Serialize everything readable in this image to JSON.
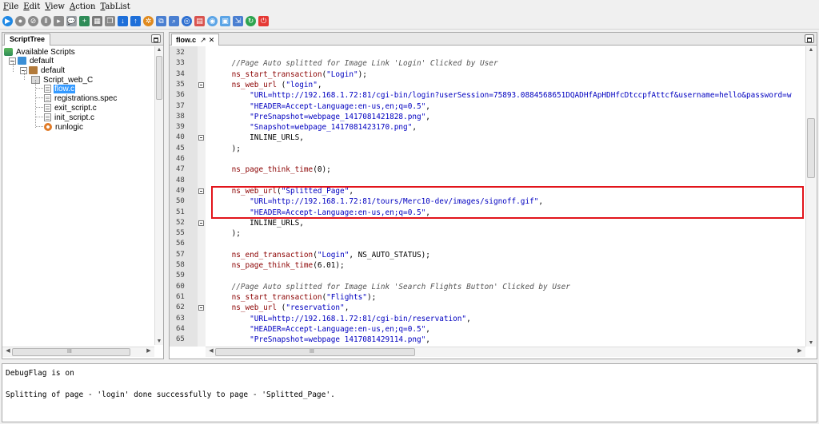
{
  "menu": [
    {
      "label": "File",
      "accel": "F"
    },
    {
      "label": "Edit",
      "accel": "E"
    },
    {
      "label": "View",
      "accel": "V"
    },
    {
      "label": "Action",
      "accel": "A"
    },
    {
      "label": "TabList",
      "accel": "T"
    }
  ],
  "toolbar": {
    "buttons": [
      {
        "name": "run-icon",
        "color": "#1e88e5",
        "shape": "round",
        "glyph": "▶"
      },
      {
        "name": "record-icon",
        "color": "#8a8a8a",
        "shape": "round",
        "glyph": "●"
      },
      {
        "name": "stop-icon",
        "color": "#8a8a8a",
        "shape": "round",
        "glyph": "⊘"
      },
      {
        "name": "pause-icon",
        "color": "#8a8a8a",
        "shape": "round",
        "glyph": "Ⅱ"
      },
      {
        "name": "step-icon",
        "color": "#8a8a8a",
        "shape": "square",
        "glyph": "▸"
      },
      {
        "name": "comment-icon",
        "color": "#9aa0a6",
        "shape": "square",
        "glyph": "💬"
      },
      {
        "name": "add-icon",
        "color": "#2e8b57",
        "shape": "square",
        "glyph": "+"
      },
      {
        "name": "grid-icon",
        "color": "#7a7a7a",
        "shape": "square",
        "glyph": "▦"
      },
      {
        "name": "copy-icon",
        "color": "#8a8a8a",
        "shape": "square",
        "glyph": "❐"
      },
      {
        "name": "move-down-icon",
        "color": "#1e6fd9",
        "shape": "square",
        "glyph": "↓"
      },
      {
        "name": "move-up-icon",
        "color": "#1e6fd9",
        "shape": "square",
        "glyph": "↑"
      },
      {
        "name": "settings-icon",
        "color": "#e08a1e",
        "shape": "round",
        "glyph": "✲"
      },
      {
        "name": "image-split-icon",
        "color": "#4a7fd1",
        "shape": "square",
        "glyph": "⧉"
      },
      {
        "name": "search-icon",
        "color": "#4a7fd1",
        "shape": "square",
        "glyph": "⌕"
      },
      {
        "name": "target-icon",
        "color": "#2d6fd1",
        "shape": "round",
        "glyph": "◎"
      },
      {
        "name": "document-icon",
        "color": "#d9534f",
        "shape": "square",
        "glyph": "▤"
      },
      {
        "name": "network-icon",
        "color": "#5ba4e6",
        "shape": "round",
        "glyph": "◉"
      },
      {
        "name": "disk-icon",
        "color": "#5ba4e6",
        "shape": "square",
        "glyph": "▣"
      },
      {
        "name": "export-icon",
        "color": "#4a7fd1",
        "shape": "square",
        "glyph": "⇲"
      },
      {
        "name": "refresh-icon",
        "color": "#2ea44f",
        "shape": "round",
        "glyph": "↻"
      },
      {
        "name": "power-icon",
        "color": "#e53935",
        "shape": "square",
        "glyph": "⏻"
      }
    ]
  },
  "script_tree": {
    "tab_label": "ScriptTree",
    "items": [
      {
        "label": "Available Scripts",
        "icon": "scripts",
        "icon_name": "scripts-icon",
        "selected": false
      },
      {
        "label": "default",
        "icon": "folder-blue",
        "icon_name": "folder-icon",
        "selected": false
      },
      {
        "label": "default",
        "icon": "folder-brown",
        "icon_name": "folder-icon",
        "selected": false
      },
      {
        "label": "Script_web_C",
        "icon": "folder-open",
        "icon_name": "script-folder-icon",
        "selected": false
      },
      {
        "label": "flow.c",
        "icon": "file",
        "icon_name": "file-icon",
        "selected": true
      },
      {
        "label": "registrations.spec",
        "icon": "file",
        "icon_name": "file-icon",
        "selected": false
      },
      {
        "label": "exit_script.c",
        "icon": "file",
        "icon_name": "file-icon",
        "selected": false
      },
      {
        "label": "init_script.c",
        "icon": "file",
        "icon_name": "file-icon",
        "selected": false
      },
      {
        "label": "runlogic",
        "icon": "gear",
        "icon_name": "runlogic-icon",
        "selected": false
      }
    ],
    "hscroll_label": "III"
  },
  "editor": {
    "tab_label": "flow.c",
    "pin_glyph": "↗",
    "close_glyph": "✕",
    "hscroll_label": "III",
    "lines": [
      {
        "n": "32",
        "fold": false,
        "segs": []
      },
      {
        "n": "33",
        "fold": false,
        "segs": [
          {
            "c": "cmt",
            "t": "    //Page Auto splitted for Image Link 'Login' Clicked by User"
          }
        ]
      },
      {
        "n": "34",
        "fold": false,
        "segs": [
          {
            "c": "fn",
            "t": "    ns_start_transaction"
          },
          {
            "c": "const",
            "t": "("
          },
          {
            "c": "str",
            "t": "\"Login\""
          },
          {
            "c": "const",
            "t": ");"
          }
        ]
      },
      {
        "n": "35",
        "fold": true,
        "segs": [
          {
            "c": "fn",
            "t": "    ns_web_url"
          },
          {
            "c": "const",
            "t": " ("
          },
          {
            "c": "str",
            "t": "\"login\""
          },
          {
            "c": "const",
            "t": ","
          }
        ]
      },
      {
        "n": "36",
        "fold": false,
        "segs": [
          {
            "c": "str",
            "t": "        \"URL=http://192.168.1.72:81/cgi-bin/login?userSession=75893.0884568651DQADHfApHDHfcDtccpfAttcf&username=hello&password=w"
          }
        ]
      },
      {
        "n": "37",
        "fold": false,
        "segs": [
          {
            "c": "str",
            "t": "        \"HEADER=Accept-Language:en-us,en;q=0.5\""
          },
          {
            "c": "const",
            "t": ","
          }
        ]
      },
      {
        "n": "38",
        "fold": false,
        "segs": [
          {
            "c": "str",
            "t": "        \"PreSnapshot=webpage_1417081421828.png\""
          },
          {
            "c": "const",
            "t": ","
          }
        ]
      },
      {
        "n": "39",
        "fold": false,
        "segs": [
          {
            "c": "str",
            "t": "        \"Snapshot=webpage_1417081423170.png\""
          },
          {
            "c": "const",
            "t": ","
          }
        ]
      },
      {
        "n": "40",
        "fold": true,
        "segs": [
          {
            "c": "const",
            "t": "        INLINE_URLS,"
          }
        ]
      },
      {
        "n": "45",
        "fold": false,
        "segs": [
          {
            "c": "const",
            "t": "    );"
          }
        ]
      },
      {
        "n": "46",
        "fold": false,
        "segs": []
      },
      {
        "n": "47",
        "fold": false,
        "segs": [
          {
            "c": "fn",
            "t": "    ns_page_think_time"
          },
          {
            "c": "const",
            "t": "(0);"
          }
        ]
      },
      {
        "n": "48",
        "fold": false,
        "segs": []
      },
      {
        "n": "49",
        "fold": true,
        "segs": [
          {
            "c": "fn",
            "t": "    ns_web_url"
          },
          {
            "c": "const",
            "t": "("
          },
          {
            "c": "str",
            "t": "\"Splitted_Page\""
          },
          {
            "c": "const",
            "t": ","
          }
        ]
      },
      {
        "n": "50",
        "fold": false,
        "segs": [
          {
            "c": "str",
            "t": "        \"URL=http://192.168.1.72:81/tours/Merc10-dev/images/signoff.gif\""
          },
          {
            "c": "const",
            "t": ","
          }
        ]
      },
      {
        "n": "51",
        "fold": false,
        "segs": [
          {
            "c": "str",
            "t": "        \"HEADER=Accept-Language:en-us,en;q=0.5\""
          },
          {
            "c": "const",
            "t": ","
          }
        ]
      },
      {
        "n": "52",
        "fold": true,
        "segs": [
          {
            "c": "const",
            "t": "        INLINE_URLS,"
          }
        ]
      },
      {
        "n": "55",
        "fold": false,
        "segs": [
          {
            "c": "const",
            "t": "    );"
          }
        ]
      },
      {
        "n": "56",
        "fold": false,
        "segs": []
      },
      {
        "n": "57",
        "fold": false,
        "segs": [
          {
            "c": "fn",
            "t": "    ns_end_transaction"
          },
          {
            "c": "const",
            "t": "("
          },
          {
            "c": "str",
            "t": "\"Login\""
          },
          {
            "c": "const",
            "t": ", NS_AUTO_STATUS);"
          }
        ]
      },
      {
        "n": "58",
        "fold": false,
        "segs": [
          {
            "c": "fn",
            "t": "    ns_page_think_time"
          },
          {
            "c": "const",
            "t": "(6.01);"
          }
        ]
      },
      {
        "n": "59",
        "fold": false,
        "segs": []
      },
      {
        "n": "60",
        "fold": false,
        "segs": [
          {
            "c": "cmt",
            "t": "    //Page Auto splitted for Image Link 'Search Flights Button' Clicked by User"
          }
        ]
      },
      {
        "n": "61",
        "fold": false,
        "segs": [
          {
            "c": "fn",
            "t": "    ns_start_transaction"
          },
          {
            "c": "const",
            "t": "("
          },
          {
            "c": "str",
            "t": "\"Flights\""
          },
          {
            "c": "const",
            "t": ");"
          }
        ]
      },
      {
        "n": "62",
        "fold": true,
        "segs": [
          {
            "c": "fn",
            "t": "    ns_web_url"
          },
          {
            "c": "const",
            "t": " ("
          },
          {
            "c": "str",
            "t": "\"reservation\""
          },
          {
            "c": "const",
            "t": ","
          }
        ]
      },
      {
        "n": "63",
        "fold": false,
        "segs": [
          {
            "c": "str",
            "t": "        \"URL=http://192.168.1.72:81/cgi-bin/reservation\""
          },
          {
            "c": "const",
            "t": ","
          }
        ]
      },
      {
        "n": "64",
        "fold": false,
        "segs": [
          {
            "c": "str",
            "t": "        \"HEADER=Accept-Language:en-us,en;q=0.5\""
          },
          {
            "c": "const",
            "t": ","
          }
        ]
      },
      {
        "n": "65",
        "fold": false,
        "segs": [
          {
            "c": "str",
            "t": "        \"PreSnapshot=webpage 1417081429114.png\""
          },
          {
            "c": "const",
            "t": ","
          }
        ]
      }
    ]
  },
  "output": {
    "lines": [
      "DebugFlag is on",
      "",
      "Splitting of page - 'login' done successfully to page - 'Splitted_Page'."
    ]
  },
  "colors": {
    "function": "#8b0000",
    "string": "#0000c0",
    "highlight_box": "#e2141b",
    "selection": "#3399ff"
  }
}
